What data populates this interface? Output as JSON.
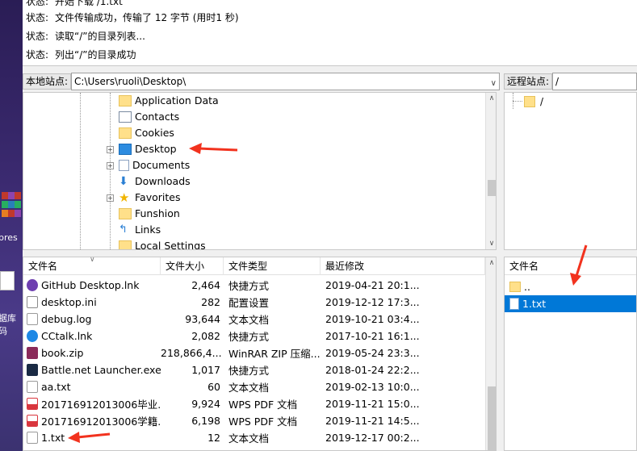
{
  "status_log": [
    {
      "key": "状态:",
      "text": "开始下载 /1.txt"
    },
    {
      "key": "状态:",
      "text": "文件传输成功，传输了 12 字节 (用时1 秒)"
    },
    {
      "key": "状态:",
      "text": "读取“/”的目录列表..."
    },
    {
      "key": "状态:",
      "text": "列出“/”的目录成功"
    }
  ],
  "desktop": {
    "item1_label": "pres",
    "item2_label": "据库",
    "item2_label2": "码"
  },
  "local": {
    "site_label": "本地站点:",
    "path": "C:\\Users\\ruoli\\Desktop\\",
    "tree": [
      {
        "label": "Application Data",
        "expandable": false,
        "icon": "folder-icon"
      },
      {
        "label": "Contacts",
        "expandable": false,
        "icon": "contacts-icon"
      },
      {
        "label": "Cookies",
        "expandable": false,
        "icon": "folder-icon"
      },
      {
        "label": "Desktop",
        "expandable": true,
        "icon": "desktop-icon"
      },
      {
        "label": "Documents",
        "expandable": true,
        "icon": "documents-icon"
      },
      {
        "label": "Downloads",
        "expandable": false,
        "icon": "download-icon"
      },
      {
        "label": "Favorites",
        "expandable": true,
        "icon": "star-icon"
      },
      {
        "label": "Funshion",
        "expandable": false,
        "icon": "folder-icon"
      },
      {
        "label": "Links",
        "expandable": false,
        "icon": "link-icon"
      },
      {
        "label": "Local Settings",
        "expandable": false,
        "icon": "folder-icon"
      }
    ],
    "columns": [
      "文件名",
      "文件大小",
      "文件类型",
      "最近修改"
    ],
    "files": [
      {
        "name": "GitHub Desktop.lnk",
        "size": "2,464",
        "type": "快捷方式",
        "modified": "2019-04-21 20:1...",
        "icon": "github-icon",
        "color": "#6e3fb0"
      },
      {
        "name": "desktop.ini",
        "size": "282",
        "type": "配置设置",
        "modified": "2019-12-12 17:3...",
        "icon": "ini-icon",
        "color": "#8a8a8a"
      },
      {
        "name": "debug.log",
        "size": "93,644",
        "type": "文本文档",
        "modified": "2019-10-21 03:4...",
        "icon": "text-icon",
        "color": "#9a9a9a"
      },
      {
        "name": "CCtalk.lnk",
        "size": "2,082",
        "type": "快捷方式",
        "modified": "2017-10-21 16:1...",
        "icon": "cctalk-icon",
        "color": "#1e88e5"
      },
      {
        "name": "book.zip",
        "size": "218,866,4...",
        "type": "WinRAR ZIP 压缩...",
        "modified": "2019-05-24 23:3...",
        "icon": "winrar-icon",
        "color": "#8b2b5a"
      },
      {
        "name": "Battle.net Launcher.exe...",
        "size": "1,017",
        "type": "快捷方式",
        "modified": "2018-01-24 22:2...",
        "icon": "battlenet-icon",
        "color": "#1a2a44"
      },
      {
        "name": "aa.txt",
        "size": "60",
        "type": "文本文档",
        "modified": "2019-02-13 10:0...",
        "icon": "text-icon",
        "color": "#9a9a9a"
      },
      {
        "name": "201716912013006毕业...",
        "size": "9,924",
        "type": "WPS PDF 文档",
        "modified": "2019-11-21 15:0...",
        "icon": "pdf-icon",
        "color": "#d9363e"
      },
      {
        "name": "201716912013006学籍...",
        "size": "6,198",
        "type": "WPS PDF 文档",
        "modified": "2019-11-21 14:5...",
        "icon": "pdf-icon",
        "color": "#d9363e"
      },
      {
        "name": "1.txt",
        "size": "12",
        "type": "文本文档",
        "modified": "2019-12-17 00:2...",
        "icon": "text-icon",
        "color": "#9a9a9a"
      }
    ]
  },
  "remote": {
    "site_label": "远程站点:",
    "path": "/",
    "tree_root": "/",
    "column": "文件名",
    "files": [
      {
        "name": "..",
        "icon": "folder-icon",
        "selected": false
      },
      {
        "name": "1.txt",
        "icon": "text-icon",
        "selected": true
      }
    ]
  }
}
